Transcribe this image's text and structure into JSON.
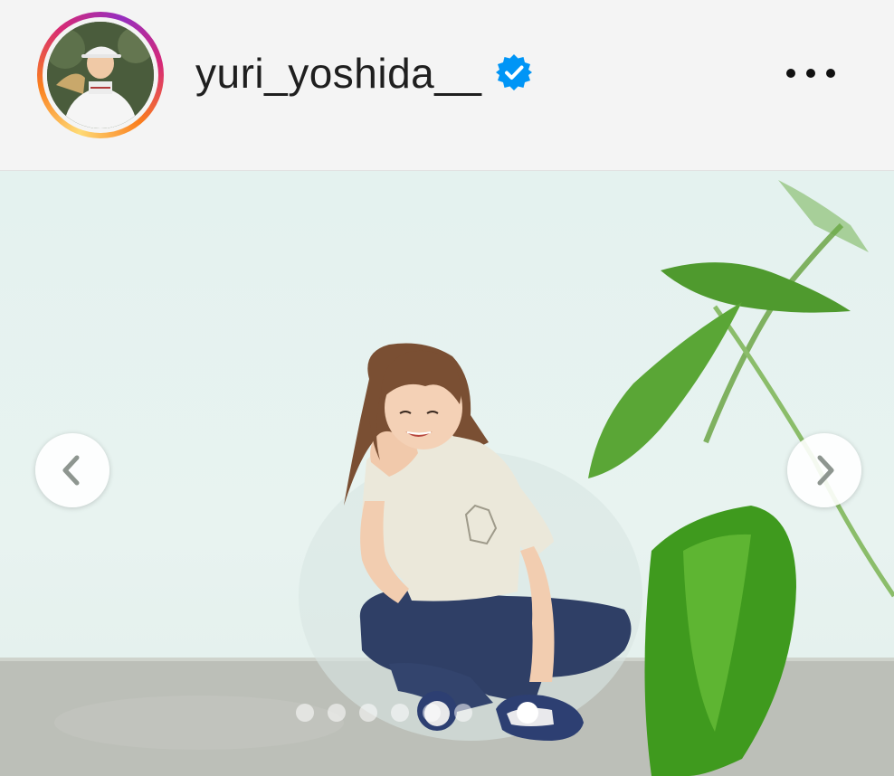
{
  "post": {
    "username": "yuri_yoshida__",
    "verified": true,
    "avatar": {
      "icon": "profile-photo-golfer",
      "story_ring": true
    },
    "more_icon": "more-horizontal-icon"
  },
  "carousel": {
    "prev_icon": "chevron-left-icon",
    "next_icon": "chevron-right-icon",
    "slide_count": 7,
    "active_slide": 7
  },
  "colors": {
    "username": "#1f1f1f",
    "verified": "#0095f6",
    "background": "#f4f4f4"
  }
}
